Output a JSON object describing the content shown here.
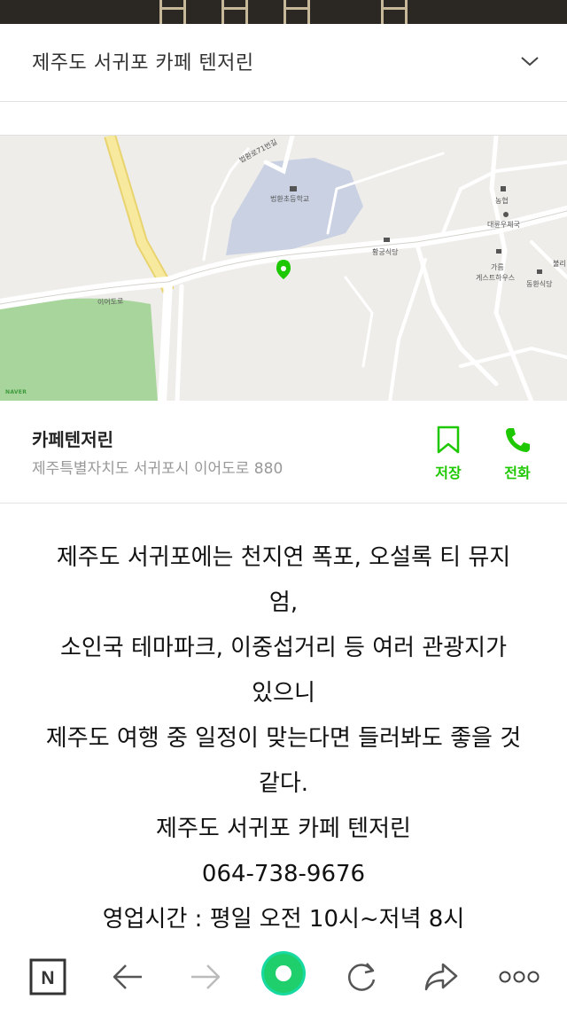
{
  "header": {
    "title": "제주도 서귀포 카페 텐저린"
  },
  "map": {
    "labels": {
      "road_top": "법환로71번길",
      "school": "법환초등학교",
      "restaurant1": "황궁식당",
      "bank": "농협",
      "post": "대륜우체국",
      "guesthouse_a": "가름",
      "guesthouse_b": "게스트하우스",
      "restaurant2": "동환식당",
      "road_left": "이어도로",
      "cut_right": "불리",
      "provider": "NAVER"
    }
  },
  "place": {
    "name": "카페텐저린",
    "address": "제주특별자치도 서귀포시 이어도로 880",
    "save_label": "저장",
    "call_label": "전화",
    "accent_color": "#1ec800"
  },
  "content": {
    "lines": [
      "제주도 서귀포에는 천지연 폭포, 오설록 티 뮤지",
      "엄,",
      "소인국 테마파크, 이중섭거리 등 여러 관광지가",
      "있으니",
      "제주도 여행 중 일정이 맞는다면 들러봐도 좋을 것",
      "같다.",
      "제주도 서귀포 카페 텐저린",
      "064-738-9676",
      "영업시간 : 평일 오전 10시~저녁 8시"
    ]
  },
  "toolbar": {
    "home_letter": "N",
    "icons": [
      "naver-home-icon",
      "back-arrow-icon",
      "forward-arrow-icon",
      "green-dot-icon",
      "refresh-icon",
      "share-icon",
      "more-icon"
    ]
  }
}
